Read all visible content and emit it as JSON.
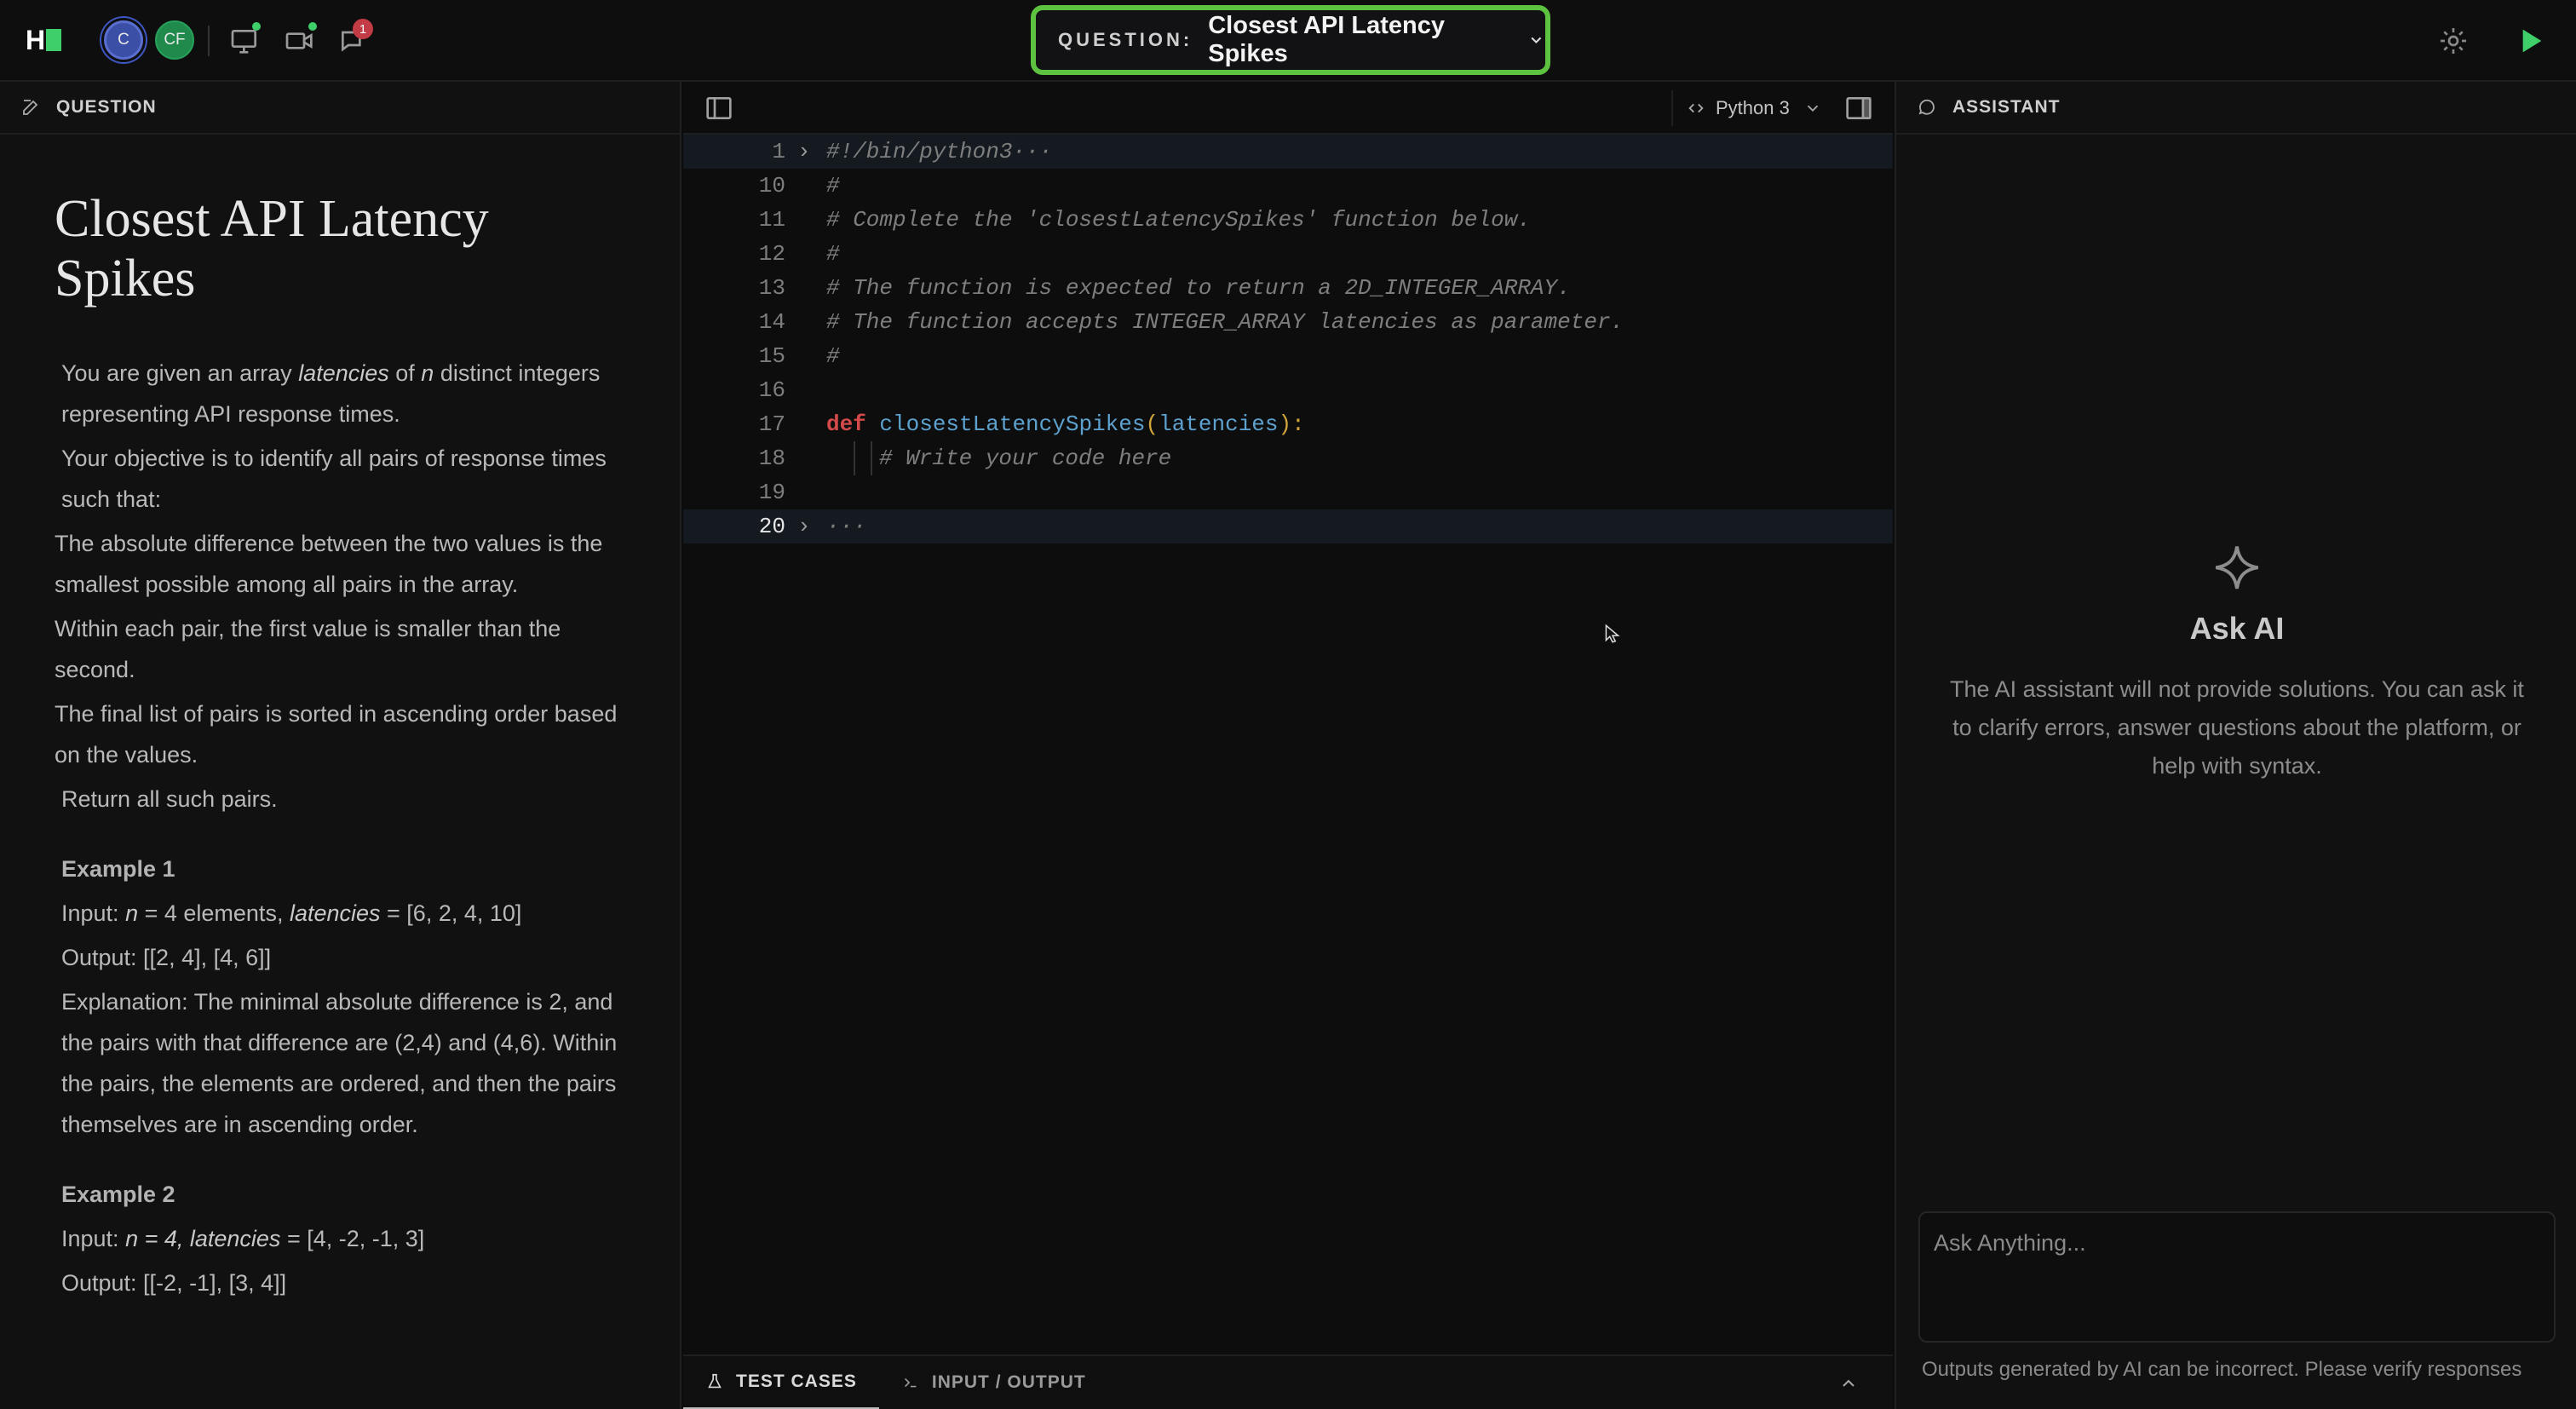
{
  "app": {
    "logo_text": "H",
    "avatars": [
      "C",
      "CF"
    ],
    "notification_count": "1"
  },
  "question_selector": {
    "label": "QUESTION:",
    "value": "Closest API Latency Spikes"
  },
  "left_panel": {
    "header": "QUESTION",
    "title": "Closest API Latency Spikes",
    "intro_a": "You are given an array ",
    "intro_var1": "latencies",
    "intro_b": " of ",
    "intro_var2": "n",
    "intro_c": " distinct integers representing API response times.",
    "objective": "Your objective is to identify all pairs of response times such that:",
    "rule1": "The absolute difference between the two values is the smallest possible among all pairs in the array.",
    "rule2": "Within each pair, the first value is smaller than the second.",
    "rule3": "The final list of pairs is sorted in ascending order based on the values.",
    "return": "Return all such pairs.",
    "ex1_title": "Example 1",
    "ex1_input_a": "Input: ",
    "ex1_input_var1": "n",
    "ex1_input_b": " = 4 elements, ",
    "ex1_input_var2": "latencies",
    "ex1_input_c": " = [6, 2, 4, 10]",
    "ex1_output": "Output: [[2, 4], [4, 6]]",
    "ex1_expl": "Explanation: The minimal absolute difference is 2, and the pairs with that difference are (2,4) and (4,6). Within the pairs, the elements are ordered, and then the pairs themselves are in ascending order.",
    "ex2_title": "Example 2",
    "ex2_input_a": "Input: ",
    "ex2_input_var": "n = 4, latencies",
    "ex2_input_b": " = [4, -2, -1, 3]",
    "ex2_output": "Output: [[-2, -1], [3, 4]]"
  },
  "editor": {
    "language": "Python 3",
    "lines": [
      {
        "n": "1",
        "text": "#!/bin/python3···"
      },
      {
        "n": "10",
        "text": "#"
      },
      {
        "n": "11",
        "text": "# Complete the 'closestLatencySpikes' function below."
      },
      {
        "n": "12",
        "text": "#"
      },
      {
        "n": "13",
        "text": "# The function is expected to return a 2D_INTEGER_ARRAY."
      },
      {
        "n": "14",
        "text": "# The function accepts INTEGER_ARRAY latencies as parameter."
      },
      {
        "n": "15",
        "text": "#"
      },
      {
        "n": "16",
        "text": ""
      },
      {
        "n": "17",
        "kw": "def",
        "fn": "closestLatencySpikes",
        "open": "(",
        "param": "latencies",
        "close": "):"
      },
      {
        "n": "18",
        "text": "# Write your code here"
      },
      {
        "n": "19",
        "text": ""
      },
      {
        "n": "20",
        "text": "···"
      }
    ],
    "tabs": [
      "TEST CASES",
      "INPUT / OUTPUT"
    ]
  },
  "assistant": {
    "header": "ASSISTANT",
    "title": "Ask AI",
    "description": "The AI assistant will not provide solutions. You can ask it to clarify errors, answer questions about the platform, or help with syntax.",
    "input_placeholder": "Ask Anything...",
    "disclaimer": "Outputs generated by AI can be incorrect. Please verify responses"
  },
  "colors": {
    "accent": "#3ecf6b",
    "selector_border": "#5cc23f",
    "badge": "#c23b45"
  }
}
